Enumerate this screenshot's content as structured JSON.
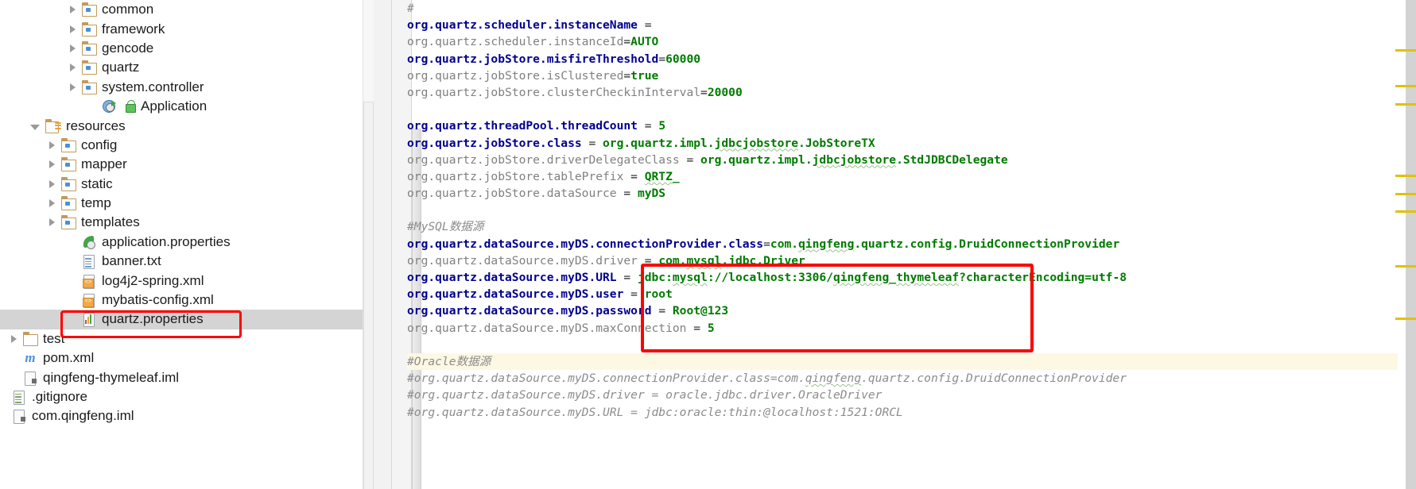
{
  "sidebar": {
    "tree": [
      {
        "label": "common",
        "indent": 88,
        "arrow": "closed",
        "icon": "folder-package-icon"
      },
      {
        "label": "framework",
        "indent": 88,
        "arrow": "closed",
        "icon": "folder-package-icon"
      },
      {
        "label": "gencode",
        "indent": 88,
        "arrow": "closed",
        "icon": "folder-package-icon"
      },
      {
        "label": "quartz",
        "indent": 88,
        "arrow": "closed",
        "icon": "folder-package-icon"
      },
      {
        "label": "system.controller",
        "indent": 88,
        "arrow": "closed",
        "icon": "folder-package-icon"
      },
      {
        "label": "Application",
        "indent": 115,
        "arrow": "none",
        "icon": "run-application-icon"
      },
      {
        "label": "resources",
        "indent": 38,
        "arrow": "open",
        "icon": "folder-resources-icon"
      },
      {
        "label": "config",
        "indent": 62,
        "arrow": "closed",
        "icon": "folder-package-icon"
      },
      {
        "label": "mapper",
        "indent": 62,
        "arrow": "closed",
        "icon": "folder-package-icon"
      },
      {
        "label": "static",
        "indent": 62,
        "arrow": "closed",
        "icon": "folder-package-icon"
      },
      {
        "label": "temp",
        "indent": 62,
        "arrow": "closed",
        "icon": "folder-package-icon"
      },
      {
        "label": "templates",
        "indent": 62,
        "arrow": "closed",
        "icon": "folder-package-icon"
      },
      {
        "label": "application.properties",
        "indent": 88,
        "arrow": "none",
        "icon": "spring-leaf-icon"
      },
      {
        "label": "banner.txt",
        "indent": 88,
        "arrow": "none",
        "icon": "text-file-icon"
      },
      {
        "label": "log4j2-spring.xml",
        "indent": 88,
        "arrow": "none",
        "icon": "xml-file-icon"
      },
      {
        "label": "mybatis-config.xml",
        "indent": 88,
        "arrow": "none",
        "icon": "xml-file-icon"
      },
      {
        "label": "quartz.properties",
        "indent": 88,
        "arrow": "none",
        "icon": "properties-file-icon",
        "selected": true,
        "annotated": true
      },
      {
        "label": "test",
        "indent": 14,
        "arrow": "closed",
        "icon": "folder-plain-icon"
      },
      {
        "label": "pom.xml",
        "indent": 14,
        "arrow": "none",
        "icon": "maven-icon"
      },
      {
        "label": "qingfeng-thymeleaf.iml",
        "indent": 14,
        "arrow": "none",
        "icon": "module-iml-icon"
      },
      {
        "label": ".gitignore",
        "indent": 0,
        "arrow": "none",
        "icon": "gitignore-icon"
      },
      {
        "label": "com.qingfeng.iml",
        "indent": 0,
        "arrow": "none",
        "icon": "module-iml-icon"
      }
    ]
  },
  "editor": {
    "file": "quartz.properties",
    "lines": [
      {
        "type": "comment",
        "text": "#"
      },
      {
        "type": "kv",
        "key": "org.quartz.scheduler.instanceName",
        "keyStyle": "bold",
        "sep": " = ",
        "value": ""
      },
      {
        "type": "kv",
        "key": "org.quartz.scheduler.instanceId",
        "keyStyle": "plain",
        "sep": "=",
        "value": "AUTO"
      },
      {
        "type": "kv",
        "key": "org.quartz.jobStore.misfireThreshold",
        "keyStyle": "bold",
        "sep": "=",
        "value": "60000"
      },
      {
        "type": "kv",
        "key": "org.quartz.jobStore.isClustered",
        "keyStyle": "plain",
        "sep": "=",
        "value": "true"
      },
      {
        "type": "kv",
        "key": "org.quartz.jobStore.clusterCheckinInterval",
        "keyStyle": "plain",
        "sep": "=",
        "value": "20000"
      },
      {
        "type": "blank",
        "text": ""
      },
      {
        "type": "kv",
        "key": "org.quartz.threadPool.threadCount",
        "keyStyle": "bold",
        "sep": " = ",
        "value": "5"
      },
      {
        "type": "kv",
        "key": "org.quartz.jobStore.class",
        "keyStyle": "bold",
        "sep": " = ",
        "value": "org.quartz.impl.jdbcjobstore.JobStoreTX"
      },
      {
        "type": "kv",
        "key": "org.quartz.jobStore.driverDelegateClass",
        "keyStyle": "plain",
        "sep": " = ",
        "value": "org.quartz.impl.jdbcjobstore.StdJDBCDelegate"
      },
      {
        "type": "kv",
        "key": "org.quartz.jobStore.tablePrefix",
        "keyStyle": "plain",
        "sep": " = ",
        "value": "QRTZ_"
      },
      {
        "type": "kv",
        "key": "org.quartz.jobStore.dataSource",
        "keyStyle": "plain",
        "sep": " = ",
        "value": "myDS"
      },
      {
        "type": "blank",
        "text": ""
      },
      {
        "type": "comment",
        "text": "#MySQL数据源"
      },
      {
        "type": "kv",
        "key": "org.quartz.dataSource.myDS.connectionProvider.class",
        "keyStyle": "bold",
        "sep": "=",
        "value": "com.qingfeng.quartz.config.DruidConnectionProvider"
      },
      {
        "type": "kv",
        "key": "org.quartz.dataSource.myDS.driver",
        "keyStyle": "plain",
        "sep": " = ",
        "value": "com.mysql.jdbc.Driver"
      },
      {
        "type": "kv",
        "key": "org.quartz.dataSource.myDS.URL",
        "keyStyle": "bold",
        "sep": " = ",
        "value": "jdbc:mysql://localhost:3306/qingfeng_thymeleaf?characterEncoding=utf-8"
      },
      {
        "type": "kv",
        "key": "org.quartz.dataSource.myDS.user",
        "keyStyle": "bold",
        "sep": " = ",
        "value": "root"
      },
      {
        "type": "kv",
        "key": "org.quartz.dataSource.myDS.password",
        "keyStyle": "bold",
        "sep": " = ",
        "value": "Root@123"
      },
      {
        "type": "kv",
        "key": "org.quartz.dataSource.myDS.maxConnection",
        "keyStyle": "plain",
        "sep": " = ",
        "value": "5"
      },
      {
        "type": "blank",
        "text": ""
      },
      {
        "type": "comment",
        "text": "#Oracle数据源",
        "highlight": true
      },
      {
        "type": "comment",
        "text": "#org.quartz.dataSource.myDS.connectionProvider.class=com.qingfeng.quartz.config.DruidConnectionProvider"
      },
      {
        "type": "comment",
        "text": "#org.quartz.dataSource.myDS.driver = oracle.jdbc.driver.OracleDriver"
      },
      {
        "type": "comment",
        "text": "#org.quartz.dataSource.myDS.URL = jdbc:oracle:thin:@localhost:1521:ORCL"
      }
    ]
  },
  "annotations": {
    "code_box_color": "#ff0000",
    "file_box_color": "#ff0000"
  },
  "markers": {
    "color": "#e0c200",
    "positions": [
      62,
      107,
      130,
      220,
      243,
      265,
      334,
      400
    ]
  },
  "colors": {
    "key_bold": "#00008f",
    "key_plain": "#808080",
    "value": "#007a00",
    "comment": "#8c8c8c",
    "selection": "#d4d4d4",
    "line_highlight": "#fdf8e3"
  }
}
